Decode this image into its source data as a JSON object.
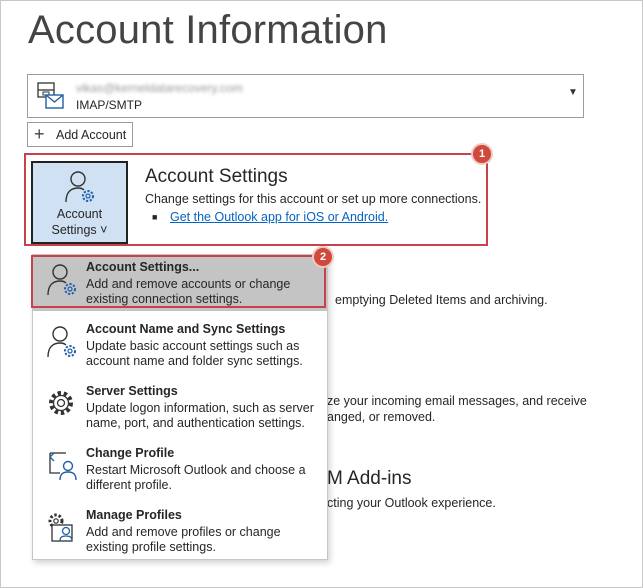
{
  "page": {
    "title": "Account Information"
  },
  "account_selector": {
    "email": "vikas@kerneldatarecovery.com",
    "type": "IMAP/SMTP"
  },
  "add_account": {
    "label": "Add Account"
  },
  "annotations": {
    "badge1": "1",
    "badge2": "2"
  },
  "account_settings_button": {
    "line1": "Account",
    "line2": "Settings ˅"
  },
  "account_settings_section": {
    "title": "Account Settings",
    "description": "Change settings for this account or set up more connections.",
    "link": "Get the Outlook app for iOS or Android."
  },
  "background": {
    "mailbox_text": "emptying Deleted Items and archiving.",
    "rules_line1": "ze your incoming email messages, and receive",
    "rules_line2": "anged, or removed.",
    "addins_heading": "M Add-ins",
    "addins_text": "cting your Outlook experience."
  },
  "menu": {
    "items": [
      {
        "title": "Account Settings...",
        "desc1": "Add and remove accounts or change",
        "desc2": "existing connection settings.",
        "icon": "account-settings-icon"
      },
      {
        "title": "Account Name and Sync Settings",
        "desc1": "Update basic account settings such as",
        "desc2": "account name and folder sync settings.",
        "icon": "account-name-sync-icon"
      },
      {
        "title": "Server Settings",
        "desc1": "Update logon information, such as server",
        "desc2": "name, port, and authentication settings.",
        "icon": "server-settings-gear-icon"
      },
      {
        "title": "Change Profile",
        "desc1": "Restart Microsoft Outlook and choose a",
        "desc2": "different profile.",
        "icon": "change-profile-icon"
      },
      {
        "title": "Manage Profiles",
        "desc1": "Add and remove profiles or change",
        "desc2": "existing profile settings.",
        "icon": "manage-profiles-icon"
      }
    ]
  },
  "colors": {
    "highlight_border": "#c8424c",
    "badge": "#cf4a3c",
    "link": "#0563c1",
    "button_selected": "#cfe1f3",
    "menu_selected": "#c4c4c4"
  }
}
